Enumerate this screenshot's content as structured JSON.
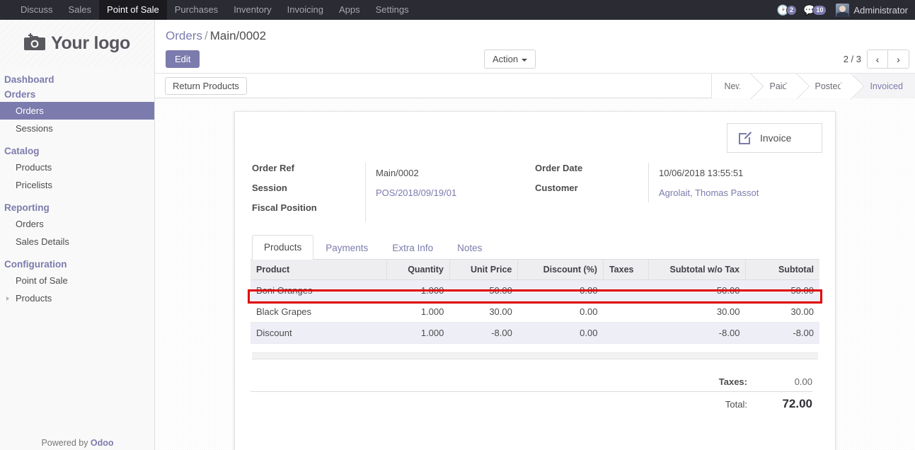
{
  "navbar": {
    "apps": [
      {
        "label": "Discuss",
        "active": false
      },
      {
        "label": "Sales",
        "active": false
      },
      {
        "label": "Point of Sale",
        "active": true
      },
      {
        "label": "Purchases",
        "active": false
      },
      {
        "label": "Inventory",
        "active": false
      },
      {
        "label": "Invoicing",
        "active": false
      },
      {
        "label": "Apps",
        "active": false
      },
      {
        "label": "Settings",
        "active": false
      }
    ],
    "activities_icon": "clock-icon",
    "activities_count": "2",
    "messages_icon": "chat-bubble-icon",
    "messages_count": "10",
    "user_name": "Administrator",
    "avatar_icon": "user-avatar"
  },
  "sidebar": {
    "logo_icon": "camera-icon",
    "logo_text": "Your logo",
    "menu": [
      {
        "label": "Dashboard",
        "type": "header"
      },
      {
        "label": "Orders",
        "type": "header"
      },
      {
        "label": "Orders",
        "type": "link",
        "selected": true
      },
      {
        "label": "Sessions",
        "type": "link",
        "selected": false
      },
      {
        "label": "Catalog",
        "type": "header"
      },
      {
        "label": "Products",
        "type": "link",
        "selected": false
      },
      {
        "label": "Pricelists",
        "type": "link",
        "selected": false
      },
      {
        "label": "Reporting",
        "type": "header"
      },
      {
        "label": "Orders",
        "type": "link",
        "selected": false
      },
      {
        "label": "Sales Details",
        "type": "link",
        "selected": false
      },
      {
        "label": "Configuration",
        "type": "header"
      },
      {
        "label": "Point of Sale",
        "type": "link",
        "selected": false
      },
      {
        "label": "Products",
        "type": "link",
        "selected": false,
        "caret": true
      }
    ],
    "footer_prefix": "Powered by ",
    "footer_brand": "Odoo"
  },
  "control_panel": {
    "breadcrumb_root": "Orders",
    "breadcrumb_separator": "/",
    "breadcrumb_current": "Main/0002",
    "edit_label": "Edit",
    "action_label": "Action",
    "pager_text": "2 / 3",
    "pager_prev_icon": "chevron-left-icon",
    "pager_next_icon": "chevron-right-icon",
    "return_products_label": "Return Products",
    "statuses": [
      {
        "label": "New",
        "active": false
      },
      {
        "label": "Paid",
        "active": false
      },
      {
        "label": "Posted",
        "active": false
      },
      {
        "label": "Invoiced",
        "active": true
      }
    ]
  },
  "form": {
    "invoice_button_label": "Invoice",
    "invoice_button_icon": "pencil-square-icon",
    "left_fields": [
      {
        "label": "Order Ref",
        "value": "Main/0002",
        "link": false
      },
      {
        "label": "Session",
        "value": "POS/2018/09/19/01",
        "link": true
      },
      {
        "label": "Fiscal Position",
        "value": "",
        "link": false
      }
    ],
    "right_fields": [
      {
        "label": "Order Date",
        "value": "10/06/2018 13:55:51",
        "link": false
      },
      {
        "label": "Customer",
        "value": "Agrolait, Thomas Passot",
        "link": true
      }
    ],
    "tabs": [
      {
        "label": "Products",
        "active": true
      },
      {
        "label": "Payments",
        "active": false
      },
      {
        "label": "Extra Info",
        "active": false
      },
      {
        "label": "Notes",
        "active": false
      }
    ],
    "table": {
      "columns": [
        {
          "label": "Product",
          "align": "left"
        },
        {
          "label": "Quantity",
          "align": "right"
        },
        {
          "label": "Unit Price",
          "align": "right"
        },
        {
          "label": "Discount (%)",
          "align": "right"
        },
        {
          "label": "Taxes",
          "align": "left"
        },
        {
          "label": "Subtotal w/o Tax",
          "align": "right"
        },
        {
          "label": "Subtotal",
          "align": "right"
        }
      ],
      "rows": [
        {
          "product": "Boni Oranges",
          "quantity": "1.000",
          "unit_price": "50.00",
          "discount": "0.00",
          "taxes": "",
          "subtotal_wo_tax": "50.00",
          "subtotal": "50.00",
          "highlighted": false
        },
        {
          "product": "Black Grapes",
          "quantity": "1.000",
          "unit_price": "30.00",
          "discount": "0.00",
          "taxes": "",
          "subtotal_wo_tax": "30.00",
          "subtotal": "30.00",
          "highlighted": false
        },
        {
          "product": "Discount",
          "quantity": "1.000",
          "unit_price": "-8.00",
          "discount": "0.00",
          "taxes": "",
          "subtotal_wo_tax": "-8.00",
          "subtotal": "-8.00",
          "highlighted": true
        }
      ]
    },
    "totals": {
      "taxes_label": "Taxes:",
      "taxes_value": "0.00",
      "total_label": "Total:",
      "total_value": "72.00"
    }
  },
  "colors": {
    "accent": "#7c7bad",
    "navbar_bg": "#2b2b33",
    "highlight_box": "#e10000",
    "row_alt_bg": "#eeeef7"
  }
}
